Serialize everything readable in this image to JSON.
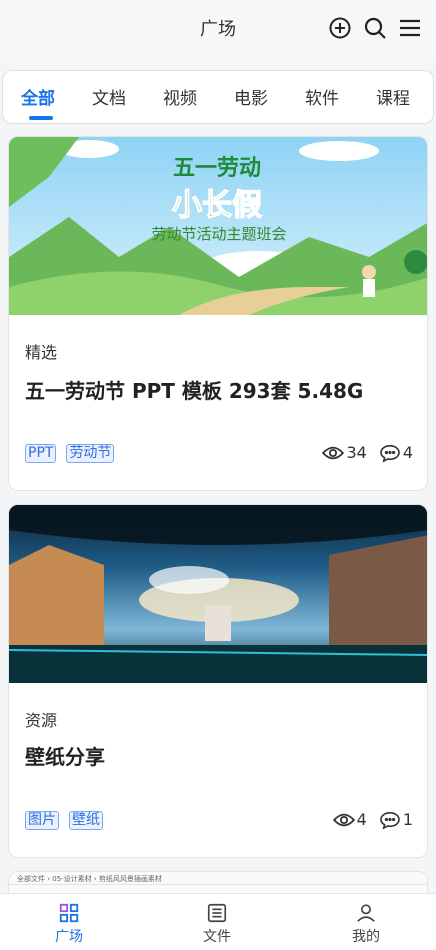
{
  "header": {
    "title": "广场",
    "icons": [
      "add-circle-icon",
      "search-icon",
      "menu-icon"
    ]
  },
  "tabs": [
    {
      "label": "全部",
      "active": true
    },
    {
      "label": "文档"
    },
    {
      "label": "视频"
    },
    {
      "label": "电影"
    },
    {
      "label": "软件"
    },
    {
      "label": "课程"
    }
  ],
  "posts": [
    {
      "image_text": {
        "line1": "五一劳动",
        "line2": "小长假",
        "line3": "劳动节活动主题班会"
      },
      "category": "精选",
      "title": "五一劳动节 PPT 模板 293套 5.48G",
      "tags": [
        "PPT",
        "劳动节"
      ],
      "views": "34",
      "comments": "4"
    },
    {
      "category": "资源",
      "title": "壁纸分享",
      "tags": [
        "图片",
        "壁纸"
      ],
      "views": "4",
      "comments": "1"
    },
    {
      "preview_text": "全部文件 › 05-设计素材 › 剪纸风风景插画素材"
    }
  ],
  "tabbar": [
    {
      "label": "广场",
      "icon": "grid-icon",
      "active": true
    },
    {
      "label": "文件",
      "icon": "file-list-icon"
    },
    {
      "label": "我的",
      "icon": "user-icon"
    }
  ],
  "colors": {
    "accent": "#1a73e8",
    "tag_text": "#2f6fe0",
    "tag_bg": "#e9f1ff"
  }
}
